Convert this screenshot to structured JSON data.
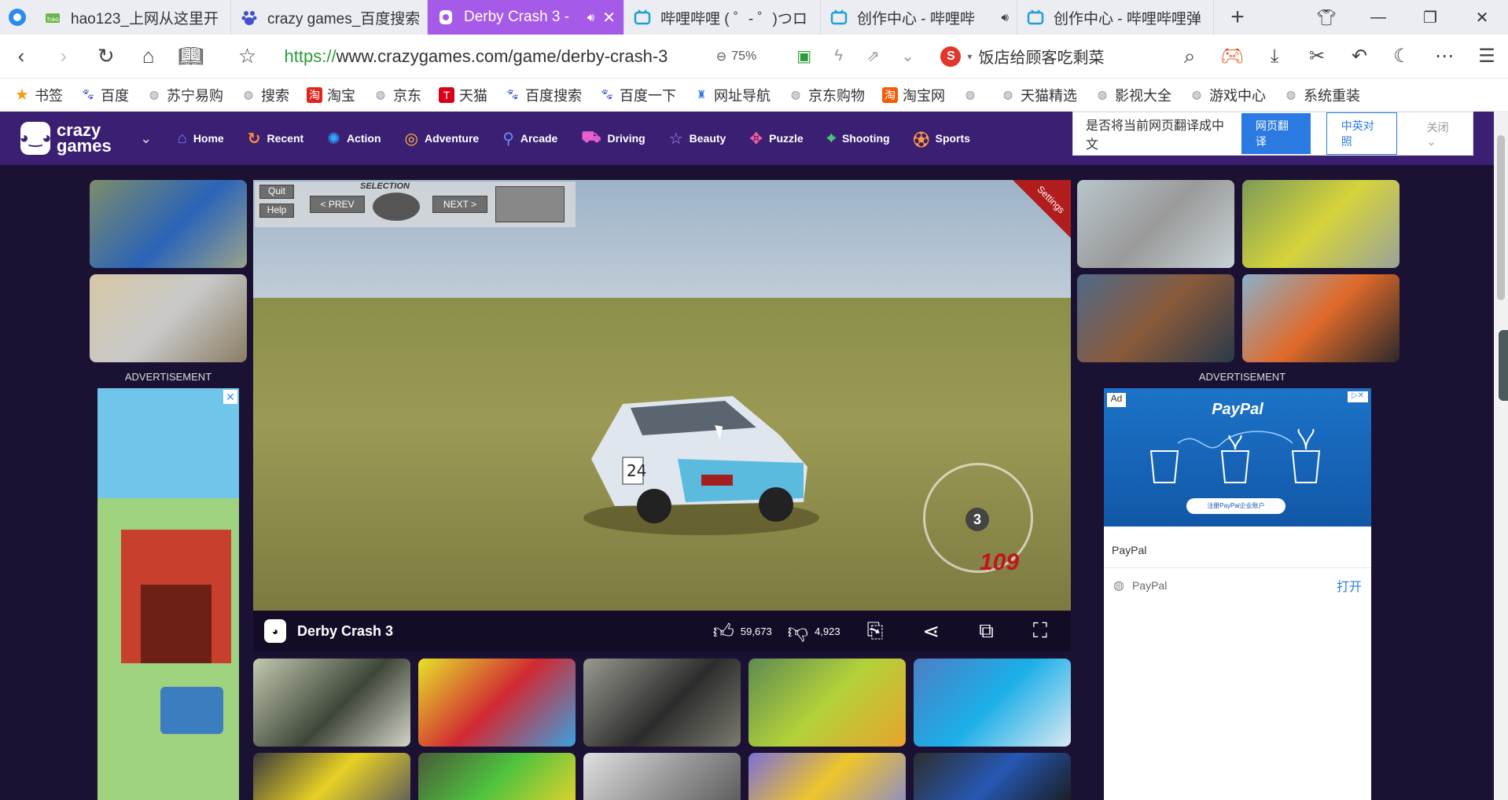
{
  "tabs": [
    {
      "title": "hao123_上网从这里开",
      "active": false,
      "audio": false
    },
    {
      "title": "crazy games_百度搜索",
      "active": false,
      "audio": false
    },
    {
      "title": "Derby Crash 3 - ",
      "active": true,
      "audio": true
    },
    {
      "title": "哔哩哔哩 ( ゜- ゜)つロ",
      "active": false,
      "audio": false
    },
    {
      "title": "创作中心 - 哔哩哔",
      "active": false,
      "audio": true
    },
    {
      "title": "创作中心 - 哔哩哔哩弹",
      "active": false,
      "audio": false
    }
  ],
  "address": {
    "protocol": "https://",
    "rest": "www.crazygames.com/game/derby-crash-3",
    "zoom": "75%",
    "search_engine_text": "饭店给顾客吃剩菜"
  },
  "bookmarks": [
    {
      "label": "书签",
      "icon": "star-icon"
    },
    {
      "label": "百度",
      "icon": "baidu-icon"
    },
    {
      "label": "苏宁易购",
      "icon": "globe-icon"
    },
    {
      "label": "搜索",
      "icon": "globe-icon"
    },
    {
      "label": "淘宝",
      "icon": "taobao-icon"
    },
    {
      "label": "京东",
      "icon": "globe-icon"
    },
    {
      "label": "天猫",
      "icon": "tmall-icon"
    },
    {
      "label": "百度搜索",
      "icon": "baidu-icon"
    },
    {
      "label": "百度一下",
      "icon": "baidu-icon"
    },
    {
      "label": "网址导航",
      "icon": "nav-icon"
    },
    {
      "label": "京东购物",
      "icon": "globe-icon"
    },
    {
      "label": "淘宝网",
      "icon": "taobao-icon"
    },
    {
      "label": "",
      "icon": "globe-icon"
    },
    {
      "label": "天猫精选",
      "icon": "globe-icon"
    },
    {
      "label": "影视大全",
      "icon": "globe-icon"
    },
    {
      "label": "游戏中心",
      "icon": "globe-icon"
    },
    {
      "label": "系统重装",
      "icon": "globe-icon"
    }
  ],
  "site": {
    "logo_line1": "crazy",
    "logo_line2": "games",
    "categories": [
      "Home",
      "Recent",
      "Action",
      "Adventure",
      "Arcade",
      "Driving",
      "Beauty",
      "Puzzle",
      "Shooting",
      "Sports"
    ]
  },
  "translate": {
    "prompt": "是否将当前网页翻译成中文",
    "translate_btn": "网页翻译",
    "compare_btn": "中英对照",
    "close_btn": "关闭"
  },
  "ads": {
    "label_left": "ADVERTISEMENT",
    "label_right": "ADVERTISEMENT",
    "right_ad": {
      "tag": "Ad",
      "brand": "PayPal",
      "pill": "注册PayPal企业账户",
      "name": "PayPal",
      "row_name": "PayPal",
      "open": "打开"
    }
  },
  "game": {
    "title": "Derby Crash 3",
    "top_buttons": {
      "quit": "Quit",
      "help": "Help",
      "prev": "< PREV",
      "next": "NEXT >",
      "selection": "SELECTION"
    },
    "settings_flag": "Settings",
    "gear": "3",
    "speed": "109",
    "car_number": "24",
    "likes": "59,673",
    "dislikes": "4,923"
  },
  "colors": {
    "nav_bg": "#3b1f73",
    "page_bg": "#1b1133",
    "active_tab": "#a65ae8",
    "accent_blue": "#2a7ae2"
  }
}
